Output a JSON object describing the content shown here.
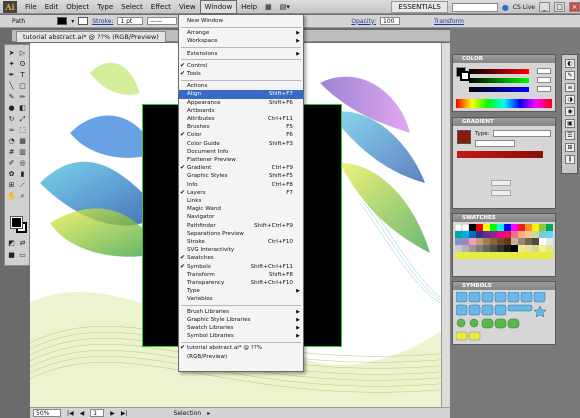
{
  "app": {
    "logo": "Ai",
    "menus": [
      "File",
      "Edit",
      "Object",
      "Type",
      "Select",
      "Effect",
      "View",
      "Window",
      "Help"
    ],
    "active_menu": "Window",
    "workspace": "ESSENTIALS",
    "cs_live": "CS Live"
  },
  "control_bar": {
    "selection": "Path",
    "stroke_label": "Stroke:",
    "stroke_value": "1 pt",
    "opacity_label": "Opacity:",
    "opacity_value": "100",
    "transform_link": "Transform"
  },
  "document": {
    "tab_title": "tutorial abstract.ai* @ ??% (RGB/Preview)"
  },
  "status_bar": {
    "zoom": "50%",
    "page": "1",
    "tool": "Selection"
  },
  "panels": {
    "color": "COLOR",
    "gradient": "GRADIENT",
    "gradient_type_label": "Type:",
    "swatches": "SWATCHES",
    "symbols": "SYMBOLS"
  },
  "window_menu": {
    "items": [
      {
        "label": "New Window",
        "shortcut": "",
        "check": false,
        "submenu": false
      },
      {
        "sep": true
      },
      {
        "label": "Arrange",
        "shortcut": "",
        "check": false,
        "submenu": true
      },
      {
        "label": "Workspace",
        "shortcut": "",
        "check": false,
        "submenu": true
      },
      {
        "sep": true
      },
      {
        "label": "Extensions",
        "shortcut": "",
        "check": false,
        "submenu": true
      },
      {
        "sep": true
      },
      {
        "label": "Control",
        "shortcut": "",
        "check": true,
        "submenu": false
      },
      {
        "label": "Tools",
        "shortcut": "",
        "check": true,
        "submenu": false
      },
      {
        "sep": true
      },
      {
        "label": "Actions",
        "shortcut": "",
        "check": false,
        "submenu": false
      },
      {
        "label": "Align",
        "shortcut": "Shift+F7",
        "check": false,
        "submenu": false,
        "highlight": true
      },
      {
        "label": "Appearance",
        "shortcut": "Shift+F6",
        "check": false,
        "submenu": false
      },
      {
        "label": "Artboards",
        "shortcut": "",
        "check": false,
        "submenu": false
      },
      {
        "label": "Attributes",
        "shortcut": "Ctrl+F11",
        "check": false,
        "submenu": false
      },
      {
        "label": "Brushes",
        "shortcut": "F5",
        "check": false,
        "submenu": false
      },
      {
        "label": "Color",
        "shortcut": "F6",
        "check": true,
        "submenu": false
      },
      {
        "label": "Color Guide",
        "shortcut": "Shift+F3",
        "check": false,
        "submenu": false
      },
      {
        "label": "Document Info",
        "shortcut": "",
        "check": false,
        "submenu": false
      },
      {
        "label": "Flattener Preview",
        "shortcut": "",
        "check": false,
        "submenu": false
      },
      {
        "label": "Gradient",
        "shortcut": "Ctrl+F9",
        "check": true,
        "submenu": false
      },
      {
        "label": "Graphic Styles",
        "shortcut": "Shift+F5",
        "check": false,
        "submenu": false
      },
      {
        "label": "Info",
        "shortcut": "Ctrl+F8",
        "check": false,
        "submenu": false
      },
      {
        "label": "Layers",
        "shortcut": "F7",
        "check": true,
        "submenu": false
      },
      {
        "label": "Links",
        "shortcut": "",
        "check": false,
        "submenu": false
      },
      {
        "label": "Magic Wand",
        "shortcut": "",
        "check": false,
        "submenu": false
      },
      {
        "label": "Navigator",
        "shortcut": "",
        "check": false,
        "submenu": false
      },
      {
        "label": "Pathfinder",
        "shortcut": "Shift+Ctrl+F9",
        "check": false,
        "submenu": false
      },
      {
        "label": "Separations Preview",
        "shortcut": "",
        "check": false,
        "submenu": false
      },
      {
        "label": "Stroke",
        "shortcut": "Ctrl+F10",
        "check": false,
        "submenu": false
      },
      {
        "label": "SVG Interactivity",
        "shortcut": "",
        "check": false,
        "submenu": false
      },
      {
        "label": "Swatches",
        "shortcut": "",
        "check": true,
        "submenu": false
      },
      {
        "label": "Symbols",
        "shortcut": "Shift+Ctrl+F11",
        "check": true,
        "submenu": false
      },
      {
        "label": "Transform",
        "shortcut": "Shift+F8",
        "check": false,
        "submenu": false
      },
      {
        "label": "Transparency",
        "shortcut": "Shift+Ctrl+F10",
        "check": false,
        "submenu": false
      },
      {
        "label": "Type",
        "shortcut": "",
        "check": false,
        "submenu": true
      },
      {
        "label": "Variables",
        "shortcut": "",
        "check": false,
        "submenu": false
      },
      {
        "sep": true
      },
      {
        "label": "Brush Libraries",
        "shortcut": "",
        "check": false,
        "submenu": true
      },
      {
        "label": "Graphic Style Libraries",
        "shortcut": "",
        "check": false,
        "submenu": true
      },
      {
        "label": "Swatch Libraries",
        "shortcut": "",
        "check": false,
        "submenu": true
      },
      {
        "label": "Symbol Libraries",
        "shortcut": "",
        "check": false,
        "submenu": true
      },
      {
        "sep": true
      },
      {
        "label": "tutorial abstract.ai* @ ??% (RGB/Preview)",
        "shortcut": "",
        "check": true,
        "submenu": false
      }
    ]
  },
  "colors": {
    "highlight": "#3a6ac8",
    "artboard": "#000000",
    "artboard_border": "#32c832"
  }
}
